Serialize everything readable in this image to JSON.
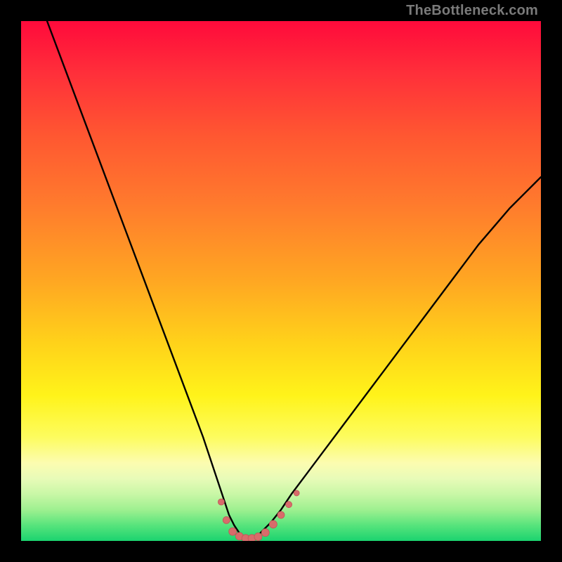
{
  "watermark": "TheBottleneck.com",
  "colors": {
    "curve": "#000000",
    "markers_fill": "#d86b6b",
    "markers_stroke": "#c15757",
    "gradient_stops": [
      "#ff0a3b",
      "#ff2f3a",
      "#ff5731",
      "#ff7a2d",
      "#ffa722",
      "#ffd21a",
      "#fff31a",
      "#fdfc5e",
      "#fcfcb0",
      "#e8fbb8",
      "#c9f7a6",
      "#9ef090",
      "#57e47c",
      "#1bd36f"
    ]
  },
  "chart_data": {
    "type": "line",
    "title": "",
    "xlabel": "",
    "ylabel": "",
    "xlim": [
      0,
      100
    ],
    "ylim": [
      0,
      100
    ],
    "grid": false,
    "legend": false,
    "series": [
      {
        "name": "bottleneck-curve",
        "x": [
          5,
          8,
          11,
          14,
          17,
          20,
          23,
          26,
          29,
          32,
          35,
          37,
          39,
          40,
          41,
          42,
          43,
          44,
          45,
          46,
          48,
          50,
          52,
          55,
          58,
          61,
          64,
          67,
          70,
          73,
          76,
          79,
          82,
          85,
          88,
          91,
          94,
          97,
          100
        ],
        "y": [
          100,
          92,
          84,
          76,
          68,
          60,
          52,
          44,
          36,
          28,
          20,
          14,
          8,
          5,
          3,
          1.5,
          0.7,
          0.5,
          0.7,
          1.5,
          3.5,
          6,
          9,
          13,
          17,
          21,
          25,
          29,
          33,
          37,
          41,
          45,
          49,
          53,
          57,
          60.5,
          64,
          67,
          70
        ]
      }
    ],
    "markers": {
      "name": "flat-bottom-markers",
      "points": [
        {
          "x": 38.5,
          "y": 7.5,
          "r": 4.5
        },
        {
          "x": 39.5,
          "y": 4.0,
          "r": 5.0
        },
        {
          "x": 40.7,
          "y": 1.8,
          "r": 5.5
        },
        {
          "x": 42.0,
          "y": 0.9,
          "r": 5.5
        },
        {
          "x": 43.2,
          "y": 0.5,
          "r": 5.5
        },
        {
          "x": 44.4,
          "y": 0.5,
          "r": 5.5
        },
        {
          "x": 45.6,
          "y": 0.8,
          "r": 5.5
        },
        {
          "x": 47.0,
          "y": 1.6,
          "r": 5.5
        },
        {
          "x": 48.5,
          "y": 3.2,
          "r": 5.5
        },
        {
          "x": 50.0,
          "y": 5.0,
          "r": 5.0
        },
        {
          "x": 51.5,
          "y": 7.0,
          "r": 4.5
        },
        {
          "x": 53.0,
          "y": 9.2,
          "r": 4.0
        }
      ]
    }
  }
}
